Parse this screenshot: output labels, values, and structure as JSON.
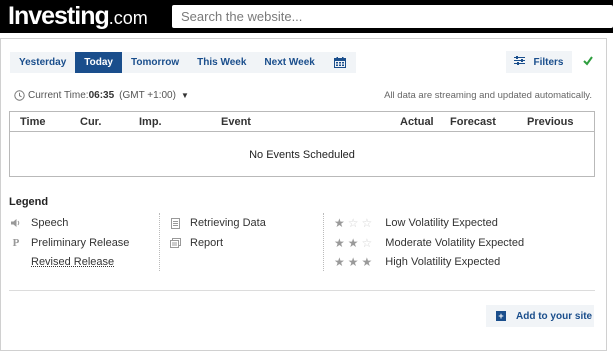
{
  "header": {
    "logo_main": "Investing",
    "logo_domain": ".com",
    "search_placeholder": "Search the website..."
  },
  "tabs": [
    {
      "label": "Yesterday",
      "active": false
    },
    {
      "label": "Today",
      "active": true
    },
    {
      "label": "Tomorrow",
      "active": false
    },
    {
      "label": "This Week",
      "active": false
    },
    {
      "label": "Next Week",
      "active": false
    }
  ],
  "filters_label": "Filters",
  "timebar": {
    "label": "Current Time:",
    "time": "06:35",
    "timezone": "(GMT +1:00)",
    "streaming_note": "All data are streaming and updated automatically."
  },
  "table": {
    "columns": [
      "Time",
      "Cur.",
      "Imp.",
      "Event",
      "Actual",
      "Forecast",
      "Previous"
    ],
    "empty_message": "No Events Scheduled"
  },
  "legend": {
    "title": "Legend",
    "col1": [
      "Speech",
      "Preliminary Release",
      "Revised Release"
    ],
    "col2": [
      "Retrieving Data",
      "Report"
    ],
    "col3": [
      {
        "label": "Low Volatility Expected",
        "stars": 1
      },
      {
        "label": "Moderate Volatility Expected",
        "stars": 2
      },
      {
        "label": "High Volatility Expected",
        "stars": 3
      }
    ]
  },
  "add_site_label": "Add to your site",
  "colors": {
    "accent": "#1a4e8c",
    "check": "#2e9e3e"
  }
}
